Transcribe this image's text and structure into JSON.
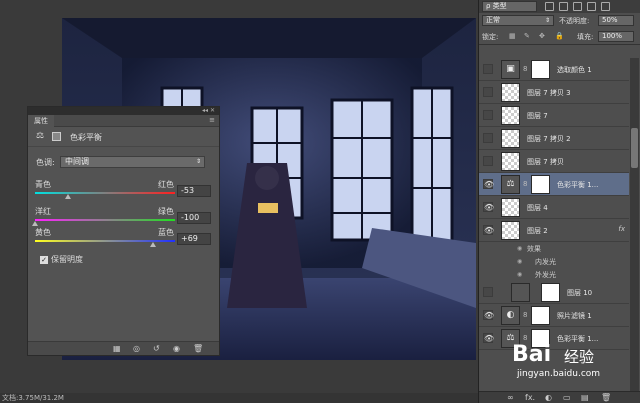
{
  "status": {
    "doc_info": "文档:3.75M/31.2M"
  },
  "properties": {
    "tab": "属性",
    "menu_icon": "≡",
    "collapse_icon": "◂◂ ✕",
    "adjust_title": "色彩平衡",
    "tone_label": "色调:",
    "tone_value": "中间调",
    "sliders": [
      {
        "left": "青色",
        "right": "红色",
        "value": "-53",
        "level": -53
      },
      {
        "left": "洋红",
        "right": "绿色",
        "value": "-100",
        "level": -100
      },
      {
        "left": "黄色",
        "right": "蓝色",
        "value": "+69",
        "level": 69
      }
    ],
    "preserve_label": "保留明度",
    "preserve_checked": "✓"
  },
  "layers_panel": {
    "kind_label": "ρ 类型",
    "blend_mode": "正常",
    "opacity_label": "不透明度:",
    "opacity_value": "50%",
    "lock_label": "锁定:",
    "fill_label": "填充:",
    "fill_value": "100%",
    "layers": [
      {
        "name": "选取颜色 1",
        "eye": "",
        "type": "adjust",
        "selected": false
      },
      {
        "name": "图层 7 拷贝 3",
        "eye": "",
        "type": "pixel",
        "selected": false
      },
      {
        "name": "图层 7",
        "eye": "",
        "type": "pixel",
        "selected": false
      },
      {
        "name": "图层 7 拷贝 2",
        "eye": "",
        "type": "pixel",
        "selected": false
      },
      {
        "name": "图层 7 拷贝",
        "eye": "",
        "type": "pixel",
        "selected": false
      },
      {
        "name": "色彩平衡 1...",
        "eye": "👁",
        "type": "adjust",
        "selected": true
      },
      {
        "name": "图层 4",
        "eye": "👁",
        "type": "pixel",
        "selected": false
      },
      {
        "name": "图层 2",
        "eye": "👁",
        "type": "pixel",
        "selected": false,
        "fx": "fx"
      }
    ],
    "effects": {
      "label": "效果",
      "items": [
        "内发光",
        "外发光"
      ]
    },
    "layers_lower": [
      {
        "name": "图层 10",
        "eye": "",
        "type": "dark"
      },
      {
        "name": "照片滤镜 1",
        "eye": "👁",
        "type": "adjust"
      },
      {
        "name": "色彩平衡 1...",
        "eye": "👁",
        "type": "adjust"
      }
    ],
    "footer_icons": [
      "∞",
      "fx.",
      "◐",
      "▭",
      "▤",
      "🗑"
    ]
  },
  "watermark": {
    "logo": "Bai",
    "text": "经验",
    "url": "jingyan.baidu.com"
  }
}
